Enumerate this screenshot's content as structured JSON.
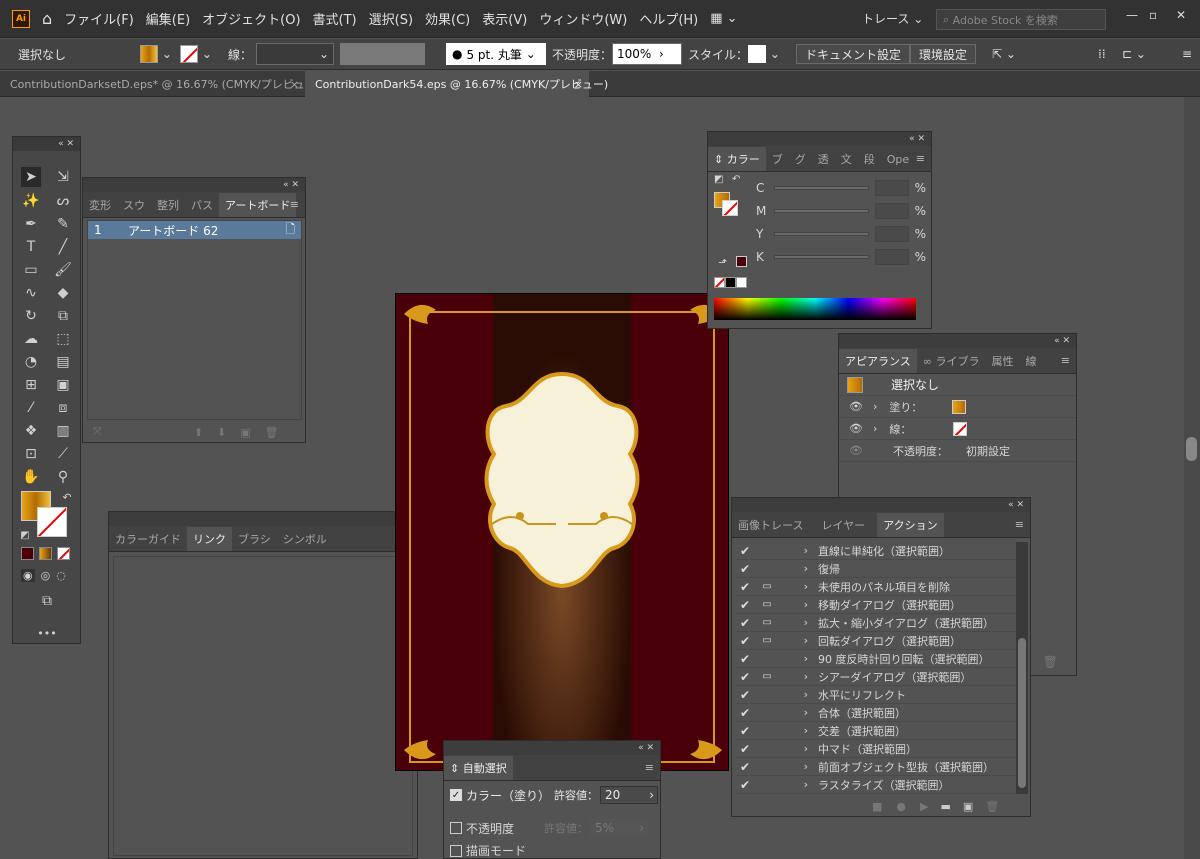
{
  "app": {
    "logo": "Ai",
    "menus": [
      "ファイル(F)",
      "編集(E)",
      "オブジェクト(O)",
      "書式(T)",
      "選択(S)",
      "効果(C)",
      "表示(V)",
      "ウィンドウ(W)",
      "ヘルプ(H)"
    ],
    "trace": "トレース",
    "stock_placeholder": "Adobe Stock を検索"
  },
  "control": {
    "selection": "選択なし",
    "stroke_label": "線：",
    "brush": "5 pt. 丸筆",
    "opacity_label": "不透明度：",
    "opacity": "100%",
    "style_label": "スタイル：",
    "doc_setup": "ドキュメント設定",
    "prefs": "環境設定"
  },
  "tabs": [
    {
      "label": "ContributionDarksetD.eps* @ 16.67% (CMYK/プレビュー)",
      "close": "×"
    },
    {
      "label": "ContributionDark54.eps @ 16.67% (CMYK/プレビュー)",
      "close": "×"
    }
  ],
  "artboards": {
    "tabs": [
      "変形",
      "スウ",
      "整列",
      "パス",
      "アートボード"
    ],
    "items": [
      {
        "num": "1",
        "name": "アートボード 62"
      }
    ]
  },
  "links": {
    "tabs": [
      "カラーガイド",
      "リンク",
      "ブラシ",
      "シンボル"
    ]
  },
  "color": {
    "tabs": [
      "カラー",
      "ブ",
      "グ",
      "透",
      "文",
      "段",
      "Ope"
    ],
    "channels": [
      "C",
      "M",
      "Y",
      "K"
    ],
    "pct": "%"
  },
  "appearance": {
    "tabs": [
      "アピアランス",
      "ライブラ",
      "属性",
      "線"
    ],
    "title": "選択なし",
    "fill": "塗り：",
    "stroke": "線：",
    "opacity_label": "不透明度：",
    "opacity_value": "初期設定"
  },
  "actions": {
    "tabs": [
      "画像トレース",
      "レイヤー",
      "アクション"
    ],
    "items": [
      "直線に単純化（選択範囲）",
      "復帰",
      "未使用のパネル項目を削除",
      "移動ダイアログ（選択範囲）",
      "拡大・縮小ダイアログ（選択範囲）",
      "回転ダイアログ（選択範囲）",
      "90 度反時計回り回転（選択範囲）",
      "シアーダイアログ（選択範囲）",
      "水平にリフレクト",
      "合体（選択範囲）",
      "交差（選択範囲）",
      "中マド（選択範囲）",
      "前面オブジェクト型抜（選択範囲）",
      "ラスタライズ（選択範囲）"
    ],
    "dialog_rows": [
      false,
      false,
      true,
      true,
      true,
      true,
      false,
      true,
      false,
      false,
      false,
      false,
      false,
      false
    ]
  },
  "autoselect": {
    "tab": "自動選択",
    "color_label": "カラー（塗り）",
    "tol_label": "許容値：",
    "tol_value": "20",
    "opacity_label": "不透明度",
    "opacity_tol": "5%",
    "blend_label": "描画モード"
  },
  "colors": {
    "accent": "#e8a317",
    "maroon": "#4a0008",
    "cream": "#f6f1d8"
  }
}
